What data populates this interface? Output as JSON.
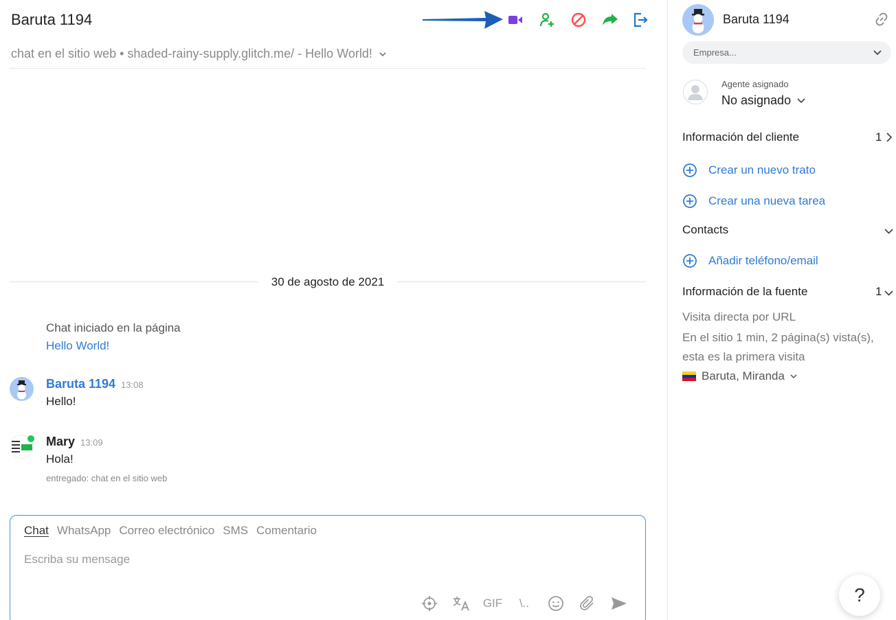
{
  "header": {
    "title": "Baruta 1194",
    "subtitle": "chat en el sitio web • shaded-rainy-supply.glitch.me/ - Hello World!",
    "colors": {
      "video": "#7b3fe4",
      "add_user": "#22b14c",
      "block": "#ff4d4d",
      "forward": "#22b14c",
      "exit": "#1d79c2",
      "arrow": "#1d5fb7"
    }
  },
  "conversation": {
    "date": "30 de agosto de 2021",
    "system_line": "Chat iniciado en la página",
    "system_link": "Hello World!",
    "messages": [
      {
        "author": "Baruta 1194",
        "time": "13:08",
        "text": "Hello!",
        "author_color": "#2f7bd6"
      },
      {
        "author": "Mary",
        "time": "13:09",
        "text": "Hola!",
        "meta": "entregado: chat en el sitio web",
        "author_color": "#222222"
      }
    ]
  },
  "composer": {
    "tabs": [
      "Chat",
      "WhatsApp",
      "Correo electrónico",
      "SMS",
      "Comentario"
    ],
    "placeholder": "Escriba su mensage",
    "tool_gif": "GIF",
    "tool_slash": "\\..",
    "tools": [
      "crosshair-icon",
      "translate-icon",
      "gif-icon",
      "command-icon",
      "emoji-icon",
      "paperclip-icon",
      "send-icon"
    ]
  },
  "sidebar": {
    "contact_name": "Baruta 1194",
    "company_placeholder": "Empresa...",
    "agent_label": "Agente asignado",
    "agent_value": "No asignado",
    "client_info_title": "Información del cliente",
    "client_info_count": "1",
    "action_deal": "Crear un nuevo trato",
    "action_task": "Crear una nueva tarea",
    "contacts_title": "Contacts",
    "action_phone": "Añadir teléfono/email",
    "source_title": "Información de la fuente",
    "source_count": "1",
    "source_direct": "Visita directa por URL",
    "source_stats_1": "En el sitio 1 min, 2 página(s) vista(s),",
    "source_stats_2": "esta es la primera visita",
    "location": "Baruta, Miranda"
  },
  "help_label": "?"
}
